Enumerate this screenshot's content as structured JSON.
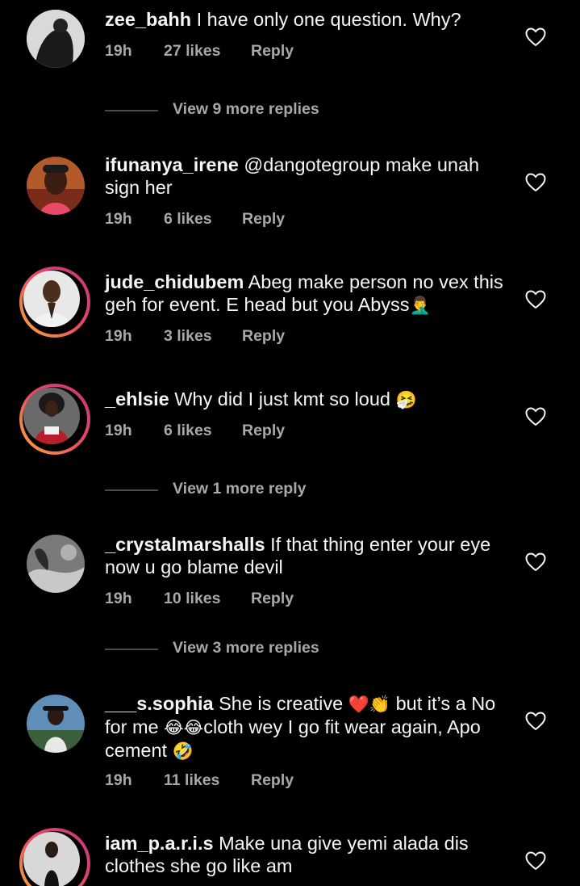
{
  "comments": [
    {
      "username": "zee_bahh",
      "text": "I have only one question. Why?",
      "time": "19h",
      "likes": "27 likes",
      "reply": "Reply",
      "view_more": "View 9 more replies"
    },
    {
      "username": "ifunanya_irene",
      "text_line1": "@dangotegroup make unah",
      "text_line2": "sign her",
      "time": "19h",
      "likes": "6 likes",
      "reply": "Reply"
    },
    {
      "username": "jude_chidubem",
      "text_line1": "Abeg make person no vex this",
      "text_line2": "geh for event. E head but you Abyss",
      "emoji": "🤦‍♂️",
      "time": "19h",
      "likes": "3 likes",
      "reply": "Reply"
    },
    {
      "username": "_ehlsie",
      "text": "Why did I just kmt so loud",
      "emoji": "🤧",
      "time": "19h",
      "likes": "6 likes",
      "reply": "Reply",
      "view_more": "View 1 more reply"
    },
    {
      "username": "_crystalmarshalls",
      "text_line1": "If that thing enter your eye",
      "text_line2": "now u go blame devil",
      "time": "19h",
      "likes": "10 likes",
      "reply": "Reply",
      "view_more": "View 3 more replies"
    },
    {
      "username": "___s.sophia",
      "text_a": "She is creative",
      "emoji_a": "❤️👏",
      "text_b": "but it’s a No",
      "text_c": "for me",
      "emoji_b": "😂😂",
      "text_d": "cloth wey I go fit wear again, Apo",
      "text_e": "cement",
      "emoji_c": "🤣",
      "time": "19h",
      "likes": "11 likes",
      "reply": "Reply"
    },
    {
      "username": "iam_p.a.r.i.s",
      "text_line1": "Make una give yemi alada dis",
      "text_line2": "clothes she go like am"
    }
  ],
  "icons": {
    "like": "heart-outline-icon"
  },
  "colors": {
    "background": "#000000",
    "text": "#f5f5f5",
    "muted": "#a8a8a8",
    "story_ring_start": "#f9b233",
    "story_ring_end": "#c13584"
  }
}
